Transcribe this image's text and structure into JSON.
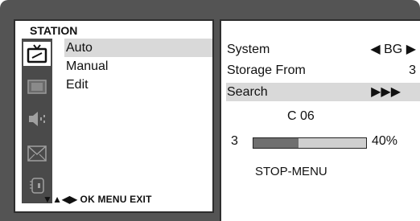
{
  "left_panel": {
    "title": "STATION",
    "menu_items": [
      "Auto",
      "Manual",
      "Edit"
    ],
    "selected_index": 0,
    "icons": [
      "tv-station-icon",
      "picture-icon",
      "sound-icon",
      "time-icon",
      "special-icon"
    ],
    "nav_hint": "▼▲◀▶  OK  MENU  EXIT"
  },
  "right_panel": {
    "system_label": "System",
    "system_value": "◀ BG ▶",
    "storage_label": "Storage From",
    "storage_value": "3",
    "search_label": "Search",
    "search_value": "▶▶▶",
    "channel": "C 06",
    "progress_label": "3",
    "progress_percent_text": "40%",
    "progress_fraction": 0.4,
    "stop_text": "STOP-MENU"
  },
  "colors": {
    "frame": "#545454",
    "highlight": "#d9d9d9",
    "bar_fill": "#6f6f6f",
    "bar_track": "#cfcfcf"
  }
}
